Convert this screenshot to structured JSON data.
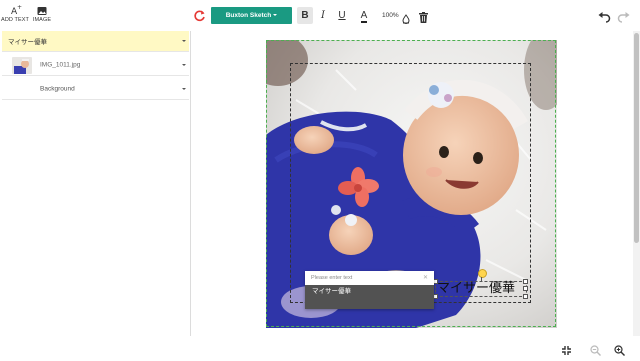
{
  "toolbar": {
    "add_text_label": "ADD TEXT",
    "image_label": "IMAGE",
    "font_name": "Buxton Sketch",
    "bold": "B",
    "italic": "I",
    "underline": "U",
    "font_color": "A",
    "zoom": "100%"
  },
  "layers": [
    {
      "label": "マイサー優華"
    },
    {
      "label": "IMG_1011.jpg"
    },
    {
      "label": "Background"
    }
  ],
  "canvas": {
    "text": "マイサー優華"
  },
  "popup": {
    "placeholder": "Please enter text",
    "close": "✕",
    "value": "マイサー優華"
  },
  "colors": {
    "accent": "#1a9a82",
    "selected_layer": "#fff9c4",
    "refresh": "#e53935"
  },
  "icons": [
    "add-text-icon",
    "image-icon",
    "refresh-icon",
    "font-color-icon",
    "fill-icon",
    "trash-icon",
    "undo-icon",
    "redo-icon",
    "compress-icon",
    "zoom-out-icon",
    "zoom-in-icon"
  ]
}
